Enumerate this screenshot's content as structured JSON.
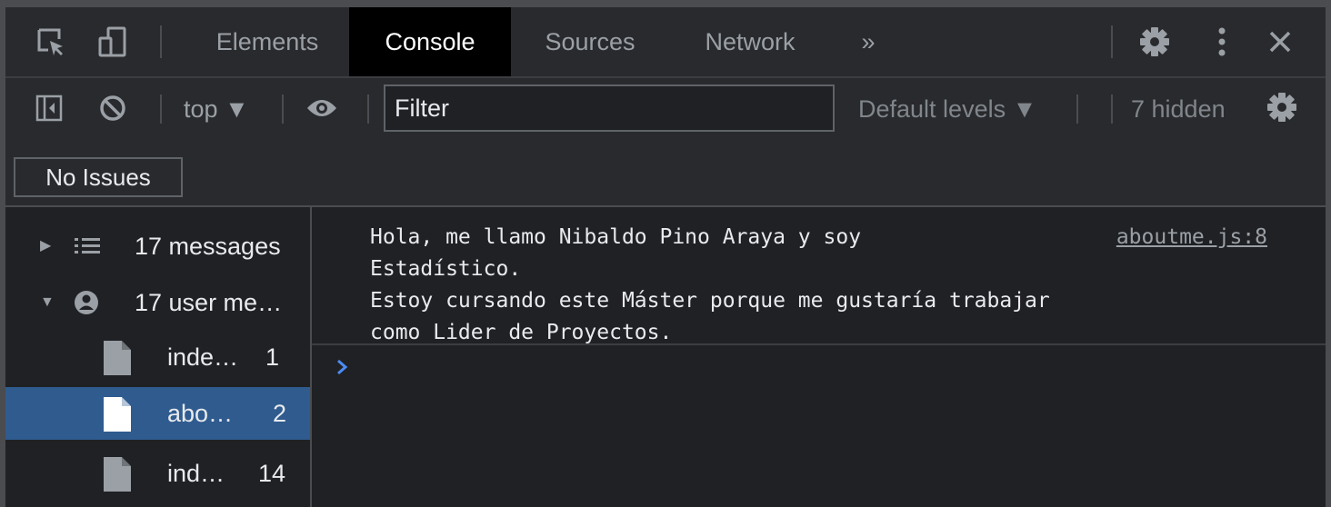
{
  "tabs": {
    "items": [
      {
        "label": "Elements"
      },
      {
        "label": "Console",
        "active": true
      },
      {
        "label": "Sources"
      },
      {
        "label": "Network"
      }
    ],
    "overflow_label": "»"
  },
  "toolbar": {
    "context": "top ▼",
    "filter_placeholder": "Filter",
    "levels": "Default levels ▼",
    "hidden_count": "7 hidden",
    "issues_label": "No Issues"
  },
  "sidebar": {
    "groups": [
      {
        "label": "17 messages",
        "expanded": false
      },
      {
        "label": "17 user me…",
        "expanded": true
      }
    ],
    "files": [
      {
        "name": "inde…",
        "count": "1"
      },
      {
        "name": "abo…",
        "count": "2",
        "selected": true
      },
      {
        "name": "ind…",
        "count": "14"
      }
    ]
  },
  "console": {
    "messages": [
      {
        "text": "Hola, me llamo Nibaldo Pino Araya y soy\nEstadístico.\nEstoy cursando este Máster porque me gustaría trabajar\ncomo Lider de Proyectos.",
        "source": "aboutme.js:8"
      }
    ]
  },
  "colors": {
    "background": "#202124",
    "toolbar": "#292a2d",
    "selected_row": "#2f5b8f",
    "prompt": "#4b8bf5"
  },
  "icons": [
    "inspect-element-icon",
    "device-toolbar-icon",
    "settings-gear-icon",
    "kebab-menu-icon",
    "close-icon",
    "sidebar-toggle-icon",
    "clear-console-icon",
    "live-expression-eye-icon",
    "list-icon",
    "user-icon",
    "file-icon",
    "prompt-chevron-icon"
  ]
}
